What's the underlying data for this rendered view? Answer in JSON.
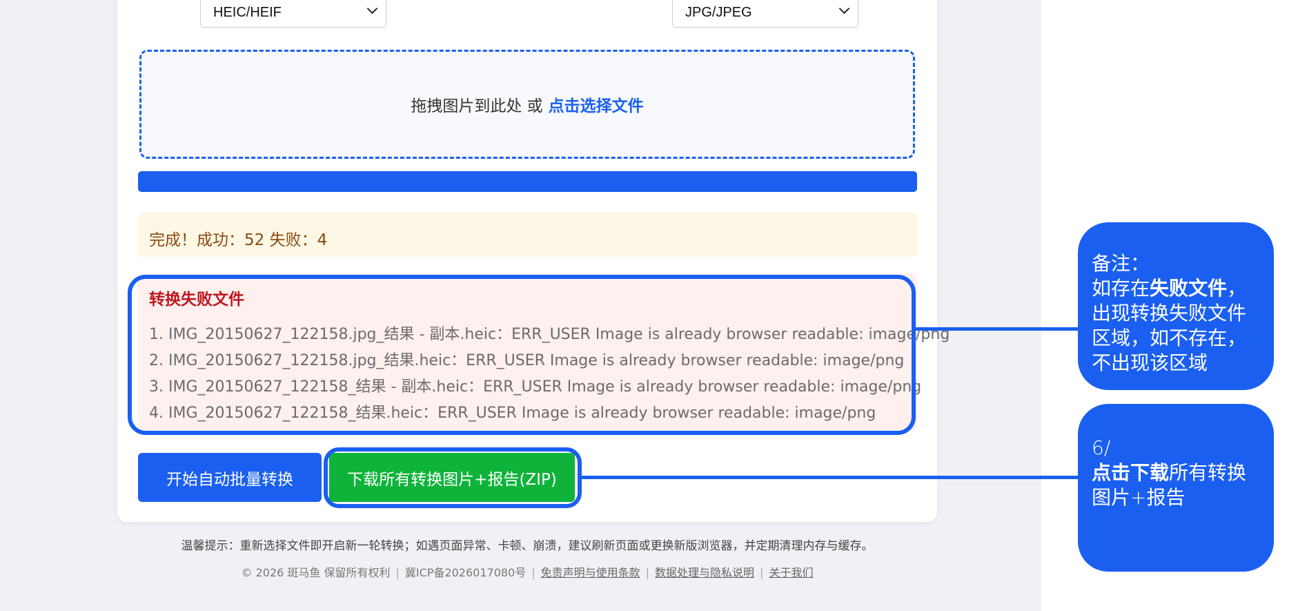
{
  "converter": {
    "source_format": "HEIC/HEIF",
    "target_format": "JPG/JPEG"
  },
  "dropzone": {
    "prompt": "拖拽图片到此处 或",
    "link": "点击选择文件"
  },
  "progress": {
    "value": 1.0
  },
  "status": {
    "text": "完成！成功：52 失败：4"
  },
  "failed_files": {
    "title": "转换失败文件",
    "items": [
      "1. IMG_20150627_122158.jpg_结果 - 副本.heic：ERR_USER Image is already browser readable: image/png",
      "2. IMG_20150627_122158.jpg_结果.heic：ERR_USER Image is already browser readable: image/png",
      "3. IMG_20150627_122158_结果 - 副本.heic：ERR_USER Image is already browser readable: image/png",
      "4. IMG_20150627_122158_结果.heic：ERR_USER Image is already browser readable: image/png"
    ]
  },
  "actions": {
    "start_label": "开始自动批量转换",
    "download_label": "下载所有转换图片+报告(ZIP)"
  },
  "tip": "温馨提示：重新选择文件即开启新一轮转换；如遇页面异常、卡顿、崩溃，建议刷新页面或更换新版浏览器，并定期清理内存与缓存。",
  "footer": {
    "copyright": "© 2026 斑马鱼 保留所有权利",
    "icp": "冀ICP备2026017080号",
    "links": [
      "免责声明与使用条款",
      "数据处理与隐私说明",
      "关于我们"
    ]
  },
  "annotations": {
    "note1": {
      "line1": "备注：",
      "l2_pre": "如存在",
      "l2_bold": "失败文件",
      "l2_post": "，",
      "line3": "出现转换失败文件",
      "line4": "区域，如不存在，",
      "line5": "不出现该区域"
    },
    "note2": {
      "line1": "6/",
      "l2_bold": "点击下载",
      "l2_post": "所有转换",
      "line3": "图片+报告"
    }
  },
  "colors": {
    "accent": "#1a5ff0",
    "success": "#0fb33a",
    "error": "#c0161d"
  }
}
